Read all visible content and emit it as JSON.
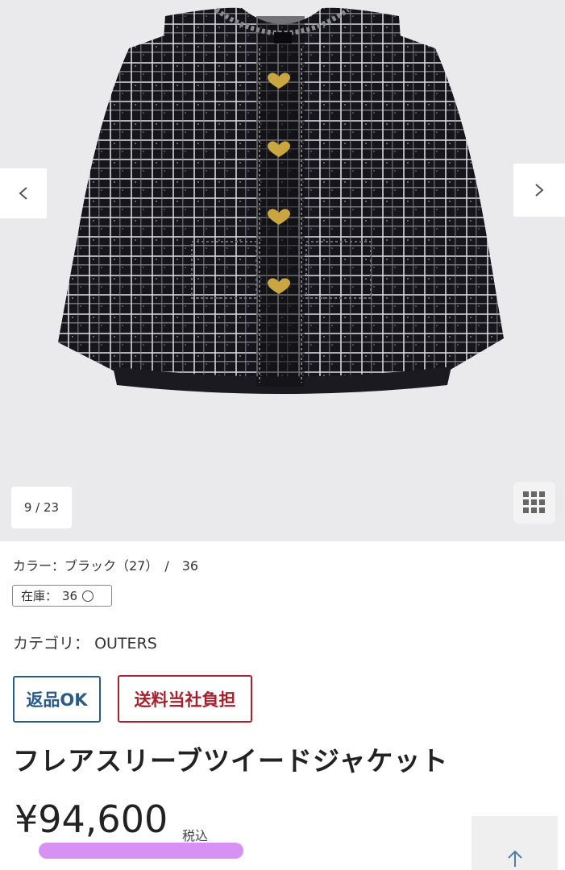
{
  "gallery": {
    "image_alt": "フレアスリーブツイードジャケット",
    "counter": "9 / 23",
    "prev_icon": "chevron-left-icon",
    "next_icon": "chevron-right-icon",
    "grid_icon": "grid-icon"
  },
  "details": {
    "color_line": "カラー：ブラック（27）　/　36",
    "stock_label": "在庫：",
    "stock_size": "36",
    "stock_mark_icon": "circle-icon",
    "category_label": "カテゴリ：",
    "category_value": "OUTERS"
  },
  "badges": {
    "return": "返品OK",
    "shipping": "送料当社負担"
  },
  "product": {
    "title": "フレアスリーブツイードジャケット",
    "price": "¥94,600",
    "tax": "税込"
  },
  "back_to_top_icon": "arrow-up-icon",
  "colors": {
    "gallery_bg": "#eaeaec",
    "return_badge": "#2b5b84",
    "shipping_badge": "#a6212e",
    "highlight": "#cf7ef0"
  }
}
